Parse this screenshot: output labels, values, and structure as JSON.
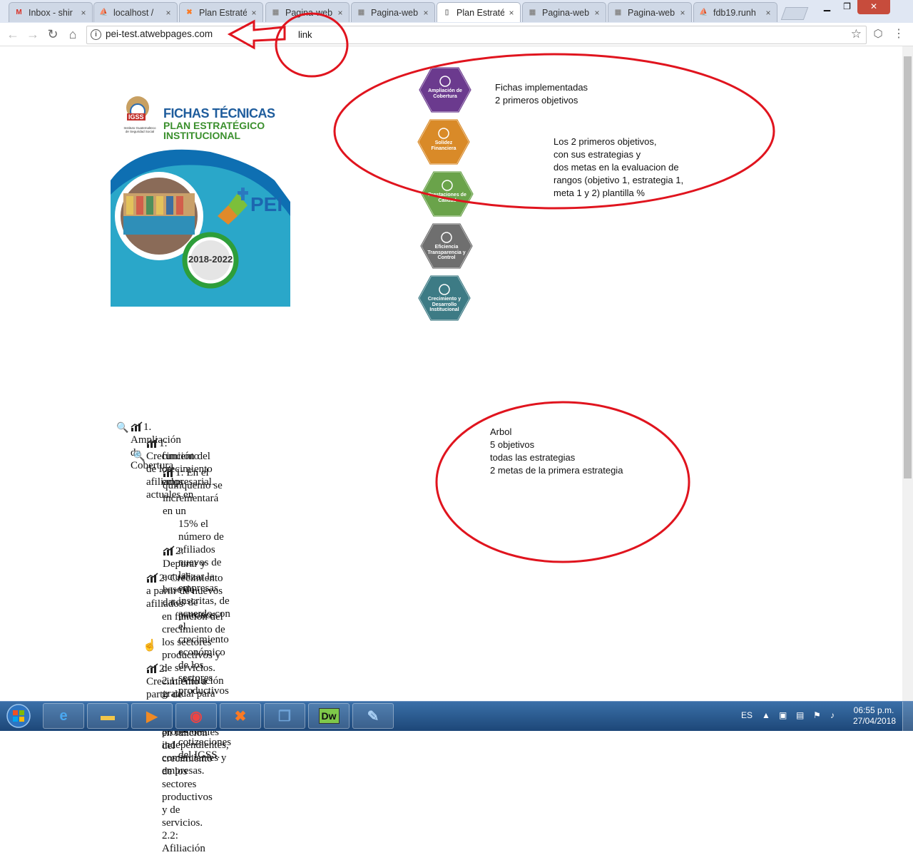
{
  "browser": {
    "tabs": [
      {
        "label": "Inbox - shir",
        "icon": "gmail-icon"
      },
      {
        "label": "localhost /",
        "icon": "phpmyadmin-icon"
      },
      {
        "label": "Plan Estraté",
        "icon": "xampp-icon"
      },
      {
        "label": "Pagina-web",
        "icon": "page-icon"
      },
      {
        "label": "Pagina-web",
        "icon": "page-icon"
      },
      {
        "label": "Plan Estraté",
        "icon": "document-icon",
        "active": true
      },
      {
        "label": "Pagina-web",
        "icon": "page-icon"
      },
      {
        "label": "Pagina-web",
        "icon": "page-icon"
      },
      {
        "label": "fdb19.runh",
        "icon": "phpmyadmin-icon"
      }
    ],
    "url": "pei-test.atwebpages.com"
  },
  "annotations": {
    "link_label": "link",
    "note_top_1": "Fichas implementadas",
    "note_top_2": "2 primeros objetivos",
    "note_mid": [
      "Los 2 primeros objetivos,",
      "con sus estrategias y",
      "dos metas en la evaluacion de",
      "rangos (objetivo 1, estrategia 1,",
      "meta 1 y 2)  plantilla %"
    ],
    "note_tree": [
      "Arbol",
      "5 objetivos",
      "todas las estrategias",
      "2 metas de la primera estrategia"
    ],
    "annotation_color": "#e0141e"
  },
  "cover": {
    "title_1": "FICHAS TÉCNICAS",
    "title_2": "PLAN ESTRATÉGICO",
    "title_3": "INSTITUCIONAL",
    "org_1": "Instituto Guatemalteco",
    "org_2": "de Seguridad Social",
    "logo_text": "IGSS",
    "brand": "PEI",
    "years": "2018-2022"
  },
  "objectives": [
    {
      "label": "Ampliación de Cobertura",
      "color": "#6b3a8e"
    },
    {
      "label": "Solidez Financiera",
      "color": "#d98a28"
    },
    {
      "label": "Prestaciones de Calidad",
      "color": "#6aa34a"
    },
    {
      "label": "Eficiencia Transparencia y Control",
      "color": "#6f6f6f"
    },
    {
      "label": "Crecimiento y Desarrollo Institucional",
      "color": "#3d7b85"
    }
  ],
  "tree": {
    "l0": "1. Ampliación de Cobertura",
    "s1_a": "1: Crecimiento de los afiliados actuales en",
    "s1_b": "función del crecimiento empresarial.",
    "m1": [
      "1: En el quinquenio se incrementará en un",
      "15% el número de afiliados nuevos de las",
      "empresas inscritas, de acuerdo con el",
      "crecimiento económico de los sectores",
      "productivos que participan en las",
      "cotizaciones del IGSS."
    ],
    "m2": [
      "2: Depurar y actualizar la base de datos de",
      "patronos."
    ],
    "s2": [
      "2: Crecimiento a partir de nuevos afiliados",
      "en función del crecimiento de los sectores",
      "productivos y de servicios. 2.1: Afiliación",
      "gradual para pequeños contribuyentes,",
      "profesionales independientes,",
      "comerciantes y empresas."
    ],
    "s3": [
      "2: Crecimiento a partir de nuevos afiliados",
      "en función del crecimiento de los sectores",
      "productivos y de servicios. 2.2: Afiliación"
    ]
  },
  "taskbar": {
    "apps": [
      "ie-icon",
      "explorer-icon",
      "media-player-icon",
      "chrome-icon",
      "xampp-icon",
      "virtualbox-icon",
      "dreamweaver-icon",
      "notepad-icon"
    ],
    "dw_label": "Dw",
    "lang": "ES",
    "time": "06:55 p.m.",
    "date": "27/04/2018"
  }
}
